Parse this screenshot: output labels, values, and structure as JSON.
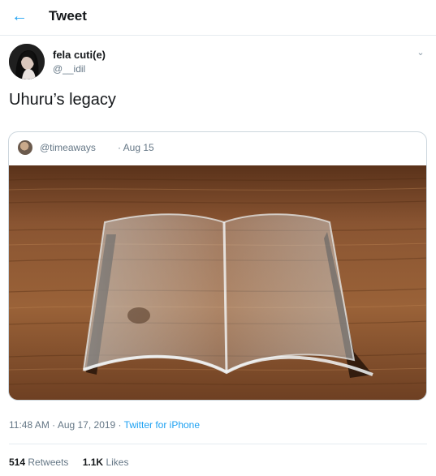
{
  "header": {
    "title": "Tweet",
    "back_icon": "arrow-left-icon",
    "accent": "#1da1f2"
  },
  "tweet": {
    "author_name": "fela cuti(e)",
    "author_handle": "@__idil",
    "text": "Uhuru’s legacy",
    "timestamp": "11:48 AM · Aug 17, 2019 · ",
    "source": "Twitter for iPhone"
  },
  "quoted_tweet": {
    "handle": "@timeaways",
    "date": "· Aug 15",
    "image_icon": "glass-book-photo"
  },
  "stats": {
    "retweets_count": "514",
    "retweets_label": "Retweets",
    "likes_count": "1.1K",
    "likes_label": "Likes"
  }
}
